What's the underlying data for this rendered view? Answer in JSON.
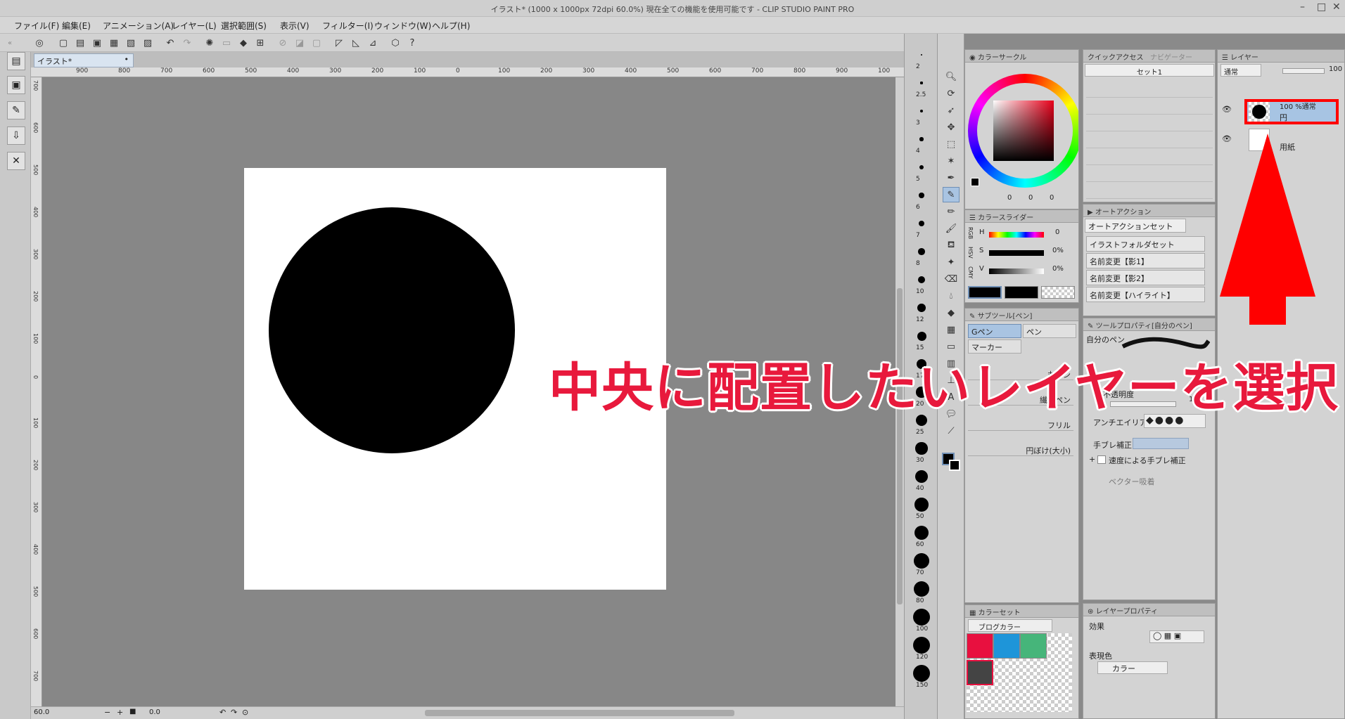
{
  "window": {
    "title": "イラスト* (1000 x 1000px 72dpi 60.0%)  現在全ての機能を使用可能です - CLIP STUDIO PAINT PRO"
  },
  "menu": {
    "items": [
      "ファイル(F)",
      "編集(E)",
      "アニメーション(A)",
      "レイヤー(L)",
      "選択範囲(S)",
      "表示(V)",
      "フィルター(I)",
      "ウィンドウ(W)",
      "ヘルプ(H)"
    ]
  },
  "document": {
    "tab_label": "イラスト*"
  },
  "ruler": {
    "h_labels": [
      "900",
      "800",
      "700",
      "600",
      "500",
      "400",
      "300",
      "200",
      "100",
      "0",
      "100",
      "200",
      "300",
      "400",
      "500",
      "600",
      "700",
      "800",
      "900",
      "100"
    ],
    "v_labels": [
      "700",
      "600",
      "500",
      "400",
      "300",
      "200",
      "100",
      "0",
      "100",
      "200",
      "300",
      "400",
      "500",
      "600",
      "700"
    ]
  },
  "status": {
    "zoom": "60.0",
    "angle": "0.0"
  },
  "brush_sizes": [
    "2",
    "2.5",
    "3",
    "4",
    "5",
    "6",
    "7",
    "8",
    "10",
    "12",
    "15",
    "17",
    "20",
    "25",
    "30",
    "40",
    "50",
    "60",
    "70",
    "80",
    "100",
    "120",
    "150"
  ],
  "color_circle": {
    "title": "カラーサークル",
    "rgb": [
      "0",
      "0",
      "0"
    ]
  },
  "color_slider": {
    "title": "カラースライダー",
    "modes": [
      "RGB",
      "HSV",
      "CMY"
    ],
    "labels": [
      "H",
      "S",
      "V"
    ],
    "values": [
      "0",
      "0%",
      "0%"
    ]
  },
  "quick_access": {
    "tab1": "クイックアクセス",
    "tab2": "ナビゲーター",
    "set": "セット1"
  },
  "auto_action": {
    "title": "オートアクション",
    "set": "オートアクションセット",
    "items": [
      "イラストフォルダセット",
      "名前変更【影1】",
      "名前変更【影2】",
      "名前変更【ハイライト】"
    ]
  },
  "subtool": {
    "title": "サブツール[ペン]",
    "tabs": [
      "Gペン",
      "ペン",
      "マーカー"
    ],
    "brushes": [
      "丸ペン",
      "繊維ペン",
      "フリル",
      "円ぼけ(大小)"
    ]
  },
  "tool_property": {
    "title": "ツールプロパティ[自分のペン]",
    "name": "自分のペン",
    "opacity_label": "不透明度",
    "opacity_value": "100",
    "antialias_label": "アンチエイリアス",
    "stabilization_label": "手ブレ補正",
    "speed_stab_label": "速度による手ブレ補正",
    "vector_snap_label": "ベクター吸着"
  },
  "color_set": {
    "title": "カラーセット",
    "set_name": "ブログカラー",
    "colors": [
      "#e8103f",
      "#1e95d9",
      "#46b57a",
      "#444444"
    ]
  },
  "layer_property": {
    "title": "レイヤープロパティ",
    "effect_label": "効果",
    "expression_label": "表現色",
    "expression_value": "カラー"
  },
  "layers": {
    "title": "レイヤー",
    "blend_mode": "通常",
    "opacity": "100",
    "items": [
      {
        "info": "100 %通常",
        "name": "円",
        "selected": true
      },
      {
        "info": "",
        "name": "用紙",
        "selected": false
      }
    ]
  },
  "annotation": {
    "callout": "中央に配置したいレイヤーを選択",
    "color": "#e8193c",
    "arrow_color": "#ff0000"
  }
}
